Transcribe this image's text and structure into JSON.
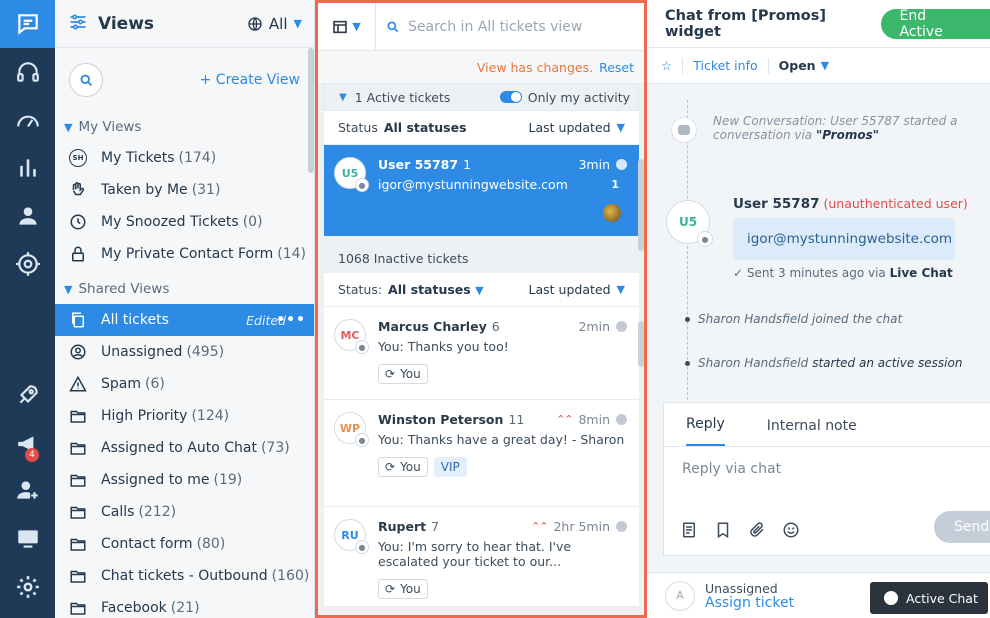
{
  "rail": {
    "items": [
      {
        "icon": "conversations-icon"
      },
      {
        "icon": "headset-icon"
      },
      {
        "icon": "dashboard-icon"
      },
      {
        "icon": "reports-icon"
      },
      {
        "icon": "contacts-icon"
      },
      {
        "icon": "target-icon"
      },
      {
        "icon": "rocket-icon"
      },
      {
        "icon": "megaphone-icon",
        "badge": "4"
      },
      {
        "icon": "add-user-icon"
      },
      {
        "icon": "monitor-icon"
      },
      {
        "icon": "settings-icon"
      }
    ]
  },
  "views": {
    "title": "Views",
    "filter": "All",
    "create_label": "Create View",
    "my_views_title": "My Views",
    "shared_views_title": "Shared Views",
    "my_views": [
      {
        "label": "My Tickets",
        "count": "(174)",
        "icon": "sh-avatar-icon",
        "icon_text": "SH"
      },
      {
        "label": "Taken by Me",
        "count": "(31)",
        "icon": "hand-icon"
      },
      {
        "label": "My Snoozed Tickets",
        "count": "(0)",
        "icon": "clock-icon"
      },
      {
        "label": "My Private Contact Form",
        "count": "(14)",
        "icon": "lock-icon"
      }
    ],
    "shared_views": [
      {
        "label": "All tickets",
        "count": "",
        "icon": "copy-icon",
        "edited": "Edited"
      },
      {
        "label": "Unassigned",
        "count": "(495)",
        "icon": "user-circle-icon"
      },
      {
        "label": "Spam",
        "count": "(6)",
        "icon": "warning-icon"
      },
      {
        "label": "High Priority",
        "count": "(124)",
        "icon": "folder-icon"
      },
      {
        "label": "Assigned to Auto Chat",
        "count": "(73)",
        "icon": "folder-icon"
      },
      {
        "label": "Assigned to me",
        "count": "(19)",
        "icon": "folder-icon"
      },
      {
        "label": "Calls",
        "count": "(212)",
        "icon": "folder-icon"
      },
      {
        "label": "Contact form",
        "count": "(80)",
        "icon": "folder-icon"
      },
      {
        "label": "Chat tickets - Outbound",
        "count": "(160)",
        "icon": "folder-icon"
      },
      {
        "label": "Facebook",
        "count": "(21)",
        "icon": "folder-icon"
      }
    ]
  },
  "list": {
    "search_placeholder": "Search in All tickets view",
    "changes_text": "View has changes.",
    "reset_label": "Reset",
    "active_header": "1 Active tickets",
    "only_my_activity": "Only my activity",
    "status_label": "Status",
    "status_value": "All statuses",
    "inactive_status_label": "Status:",
    "sort_label": "Last updated",
    "inactive_header": "1068 Inactive tickets",
    "active_ticket": {
      "initials": "U5",
      "name": "User 55787",
      "num": "1",
      "time": "3min",
      "email": "igor@mystunningwebsite.com",
      "count": "1"
    },
    "tickets": [
      {
        "initials": "MC",
        "initials_color": "#e35b5b",
        "name": "Marcus Charley",
        "num": "6",
        "time": "2min",
        "priority": false,
        "msg": "You: Thanks you too!",
        "tags": [
          "You"
        ]
      },
      {
        "initials": "WP",
        "initials_color": "#e8904e",
        "name": "Winston Peterson",
        "num": "11",
        "time": "8min",
        "priority": true,
        "msg": "You: Thanks have a great day! - Sharon",
        "tags": [
          "You",
          "VIP"
        ]
      },
      {
        "initials": "RU",
        "initials_color": "#2d8be6",
        "name": "Rupert",
        "num": "7",
        "time": "2hr 5min",
        "priority": true,
        "msg": "You: I'm sorry to hear that. I've escalated your ticket to our...",
        "tags": [
          "You"
        ]
      }
    ]
  },
  "chat": {
    "title": "Chat from [Promos] widget",
    "end_label": "End Active",
    "ticket_info": "Ticket info",
    "status": "Open",
    "system_message": "New Conversation: User 55787 started a conversation via ",
    "system_source": "\"Promos\"",
    "avatar_initials": "U5",
    "sender": "User 55787",
    "unauth": "(unauthenticated user)",
    "message": "igor@mystunningwebsite.com",
    "sent_text": "Sent 3 minutes ago via ",
    "sent_channel": "Live Chat",
    "event1": "Sharon Handsfield joined the chat",
    "event2_name": "Sharon Handsfield",
    "event2_action": "started an active session",
    "reply_tab": "Reply",
    "note_tab": "Internal note",
    "reply_placeholder": "Reply via chat",
    "send_label": "Send",
    "assign_avatar": "A",
    "assign_status": "Unassigned",
    "assign_link": "Assign ticket",
    "active_chat_label": "Active Chat"
  }
}
